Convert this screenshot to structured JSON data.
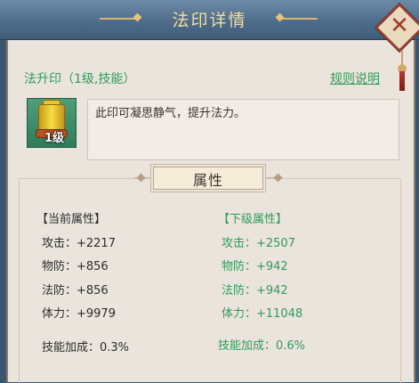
{
  "window": {
    "title": "法印详情"
  },
  "skill": {
    "name": "法升印（1级,技能）",
    "rules_link": "规则说明",
    "level_badge": "1级",
    "description": "此印可凝思静气，提升法力。"
  },
  "attributes": {
    "section_title": "属性",
    "current": {
      "header": "【当前属性】",
      "rows": [
        {
          "text": "攻击：+2217"
        },
        {
          "text": "物防：+856"
        },
        {
          "text": "法防：+856"
        },
        {
          "text": "体力：+9979"
        },
        {
          "text": "技能加成：0.3%"
        }
      ]
    },
    "next": {
      "header": "【下级属性】",
      "rows": [
        {
          "text": "攻击：+2507"
        },
        {
          "text": "物防：+942"
        },
        {
          "text": "法防：+942"
        },
        {
          "text": "体力：+11048"
        },
        {
          "text": "技能加成：0.6%"
        }
      ]
    }
  },
  "icons": {
    "close": "close-icon",
    "seal": "seal-icon"
  },
  "colors": {
    "accent_green": "#2e9c5a",
    "title_gold": "#f3dda0",
    "header_blue": "#4f6d8a"
  }
}
